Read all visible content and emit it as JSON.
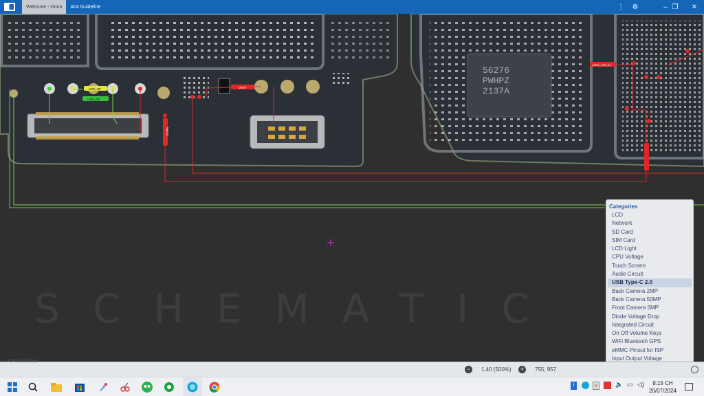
{
  "window": {
    "tabs": [
      "Welcome - Orion",
      "A04 Guideline"
    ],
    "settings_icon": "gear-icon",
    "controls": [
      "more-icon",
      "minimize-icon",
      "restore-icon",
      "close-icon"
    ]
  },
  "board": {
    "watermark": "SCHEMATIC",
    "net_labels": [
      "USB_DP",
      "USB_DN",
      "VBAT",
      "VBUS",
      "USB3_USB_IN"
    ],
    "chip_marking": [
      "56276",
      "PWHPZ",
      "2137A"
    ]
  },
  "categories": {
    "title": "Categories",
    "items": [
      "LCD",
      "Network",
      "SD Card",
      "SIM Card",
      "LCD Light",
      "CPU Voltage",
      "Touch Screen",
      "Audio Circuit",
      "USB Type-C 2.0",
      "Back Camera 2MP",
      "Back Camera 50MP",
      "Front Camera 5MP",
      "Diode Voltage Drop",
      "Integrated Circuit",
      "On Off Volume Keys",
      "WiFi Bluetooth GPS",
      "eMMC Pinout for ISP",
      "Input Output Voltage"
    ],
    "selected": "USB Type-C 2.0"
  },
  "status": {
    "zoom": "1,40 (500%)",
    "coords": "755, 957",
    "faded_label": "A04 Guideline"
  },
  "taskbar": {
    "time": "8:15 CH",
    "date": "20/07/2024"
  },
  "colors": {
    "titlebar": "#1565b8",
    "trace_red": "#d42a2a",
    "trace_green": "#7ed04f",
    "trace_yellow": "#e6e63a",
    "board": "#2b2f33",
    "selected_item": "#c9d3e3"
  }
}
